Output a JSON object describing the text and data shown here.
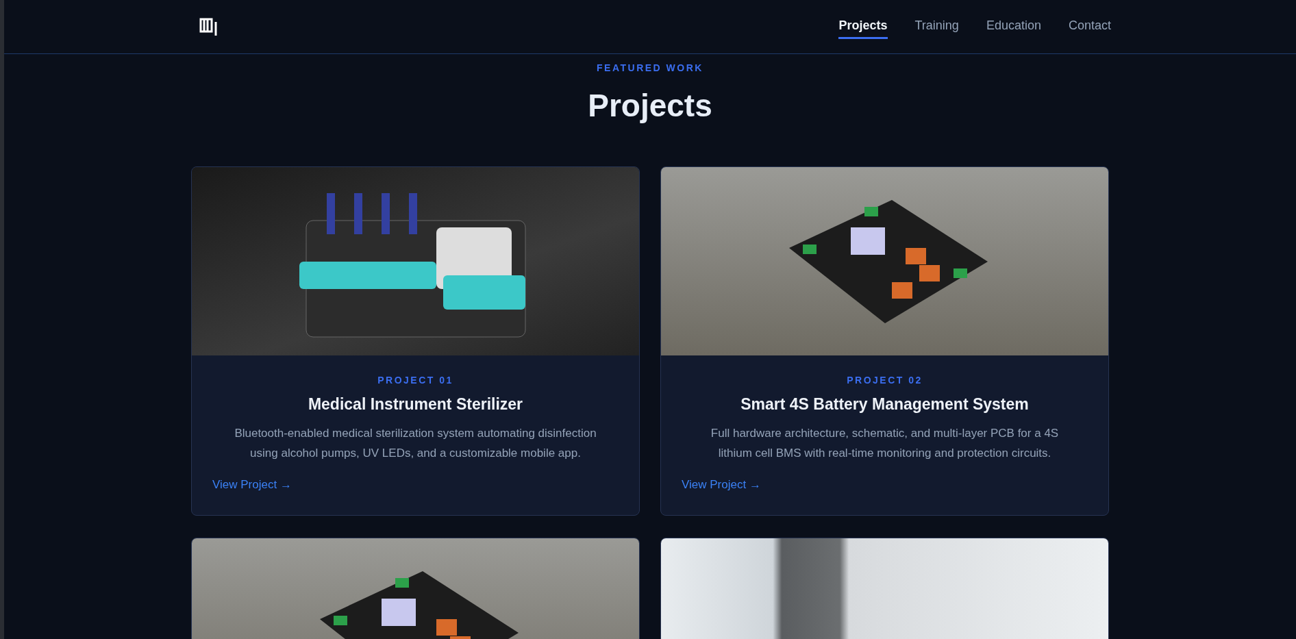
{
  "nav": {
    "links": [
      {
        "label": "Projects",
        "selected": true
      },
      {
        "label": "Training",
        "selected": false
      },
      {
        "label": "Education",
        "selected": false
      },
      {
        "label": "Contact",
        "selected": false
      }
    ]
  },
  "section": {
    "eyebrow": "FEATURED WORK",
    "title": "Projects"
  },
  "projects": [
    {
      "kind": "full",
      "number": "PROJECT 01",
      "title": "Medical Instrument Sterilizer",
      "description": "Bluetooth-enabled medical sterilization system automating disinfection using alcohol pumps, UV LEDs, and a customizable mobile app.",
      "link": "View Project →"
    },
    {
      "kind": "full",
      "number": "PROJECT 02",
      "title": "Smart 4S Battery Management System",
      "description": "Full hardware architecture, schematic, and multi-layer PCB for a 4S lithium cell BMS with real-time monitoring and protection circuits.",
      "link": "View Project →"
    },
    {
      "kind": "image_only"
    },
    {
      "kind": "image_only"
    }
  ]
}
